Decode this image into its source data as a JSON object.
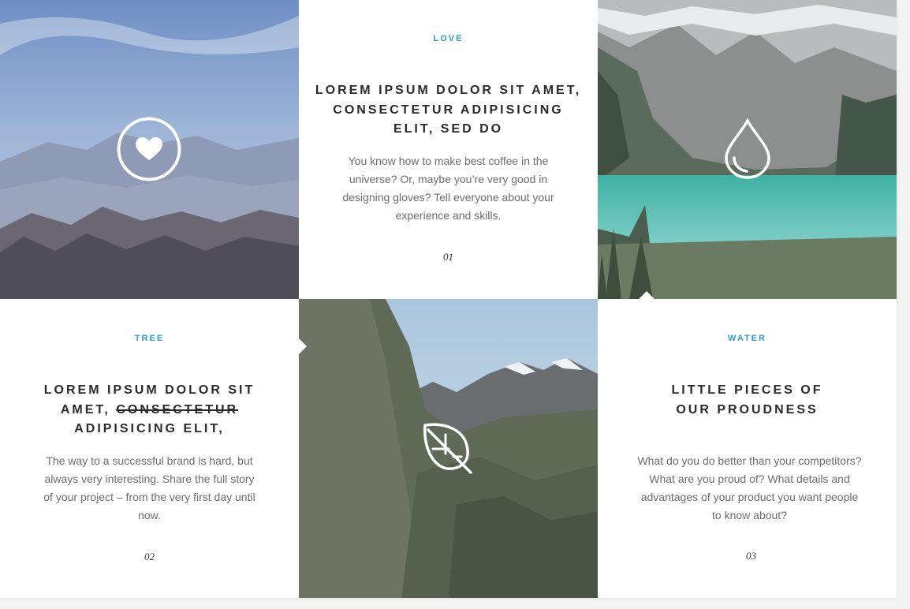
{
  "cards": [
    {
      "kicker": "LOVE",
      "heading_lines": [
        "LOREM IPSUM DOLOR SIT AMET,",
        "CONSECTETUR ADIPISICING",
        "ELIT, SED DO"
      ],
      "body": "You know how to make best coffee in the universe? Or, maybe you’re very good in designing gloves? Tell everyone about your experience and skills.",
      "number": "01",
      "icon": "heart-icon"
    },
    {
      "kicker": "TREE",
      "heading_pre": "LOREM IPSUM DOLOR SIT AMET,",
      "heading_strike": "CONSECTETUR",
      "heading_post": "ADIPISICING ELIT,",
      "body": "The way to a successful brand is hard, but always very interesting. Share the full story of your project – from the very first day until now.",
      "number": "02",
      "icon": "leaf-icon"
    },
    {
      "kicker": "WATER",
      "heading_lines": [
        "LITTLE PIECES OF",
        "OUR PROUDNESS"
      ],
      "body": "What do you do better than your competitors? What are you proud of? What details and advantages of your product you want people to know about?",
      "number": "03",
      "icon": "water-drop-icon"
    }
  ],
  "colors": {
    "accent": "#2f9ccc",
    "heading": "#2a2a2a",
    "body_text": "#6d6d6d"
  }
}
